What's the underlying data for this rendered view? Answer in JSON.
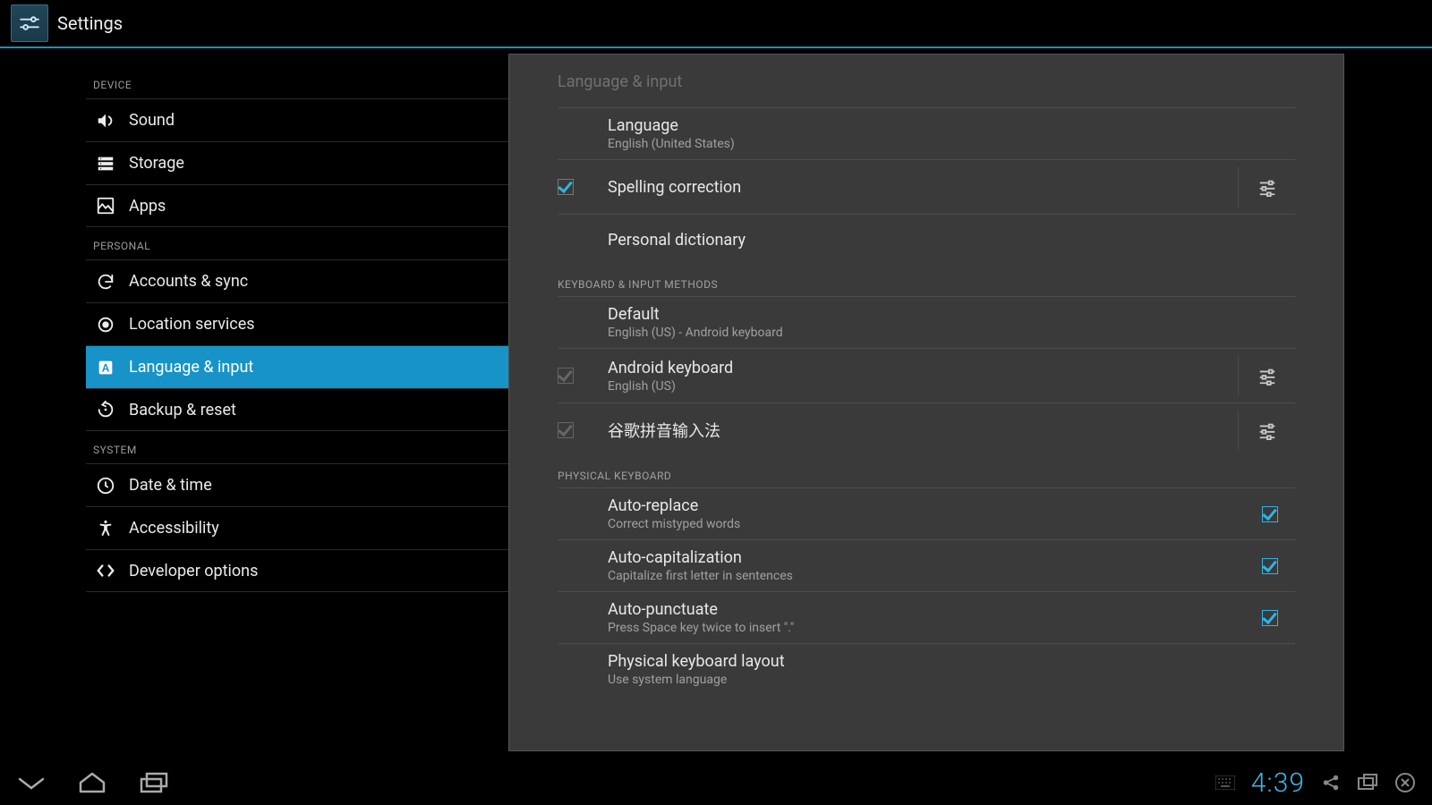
{
  "app": {
    "title": "Settings"
  },
  "sidebar": {
    "categories": [
      {
        "label": "DEVICE",
        "items": [
          {
            "id": "sound",
            "label": "Sound"
          },
          {
            "id": "storage",
            "label": "Storage"
          },
          {
            "id": "apps",
            "label": "Apps"
          }
        ]
      },
      {
        "label": "PERSONAL",
        "items": [
          {
            "id": "accounts",
            "label": "Accounts & sync"
          },
          {
            "id": "location",
            "label": "Location services"
          },
          {
            "id": "lang",
            "label": "Language & input",
            "selected": true
          },
          {
            "id": "backup",
            "label": "Backup & reset"
          }
        ]
      },
      {
        "label": "SYSTEM",
        "items": [
          {
            "id": "datetime",
            "label": "Date & time"
          },
          {
            "id": "access",
            "label": "Accessibility"
          },
          {
            "id": "dev",
            "label": "Developer options"
          }
        ]
      }
    ]
  },
  "pane": {
    "title": "Language & input",
    "language": {
      "label": "Language",
      "value": "English (United States)"
    },
    "spelling": {
      "label": "Spelling correction",
      "checked": true
    },
    "dictionary": {
      "label": "Personal dictionary"
    },
    "section_kbim": "KEYBOARD & INPUT METHODS",
    "default_kb": {
      "label": "Default",
      "value": "English (US) - Android keyboard"
    },
    "android_kb": {
      "label": "Android keyboard",
      "value": "English (US)",
      "checked": true,
      "dim": true
    },
    "pinyin_kb": {
      "label": "谷歌拼音输入法",
      "checked": true,
      "dim": true
    },
    "section_phys": "PHYSICAL KEYBOARD",
    "auto_replace": {
      "label": "Auto-replace",
      "value": "Correct mistyped words",
      "checked": true
    },
    "auto_cap": {
      "label": "Auto-capitalization",
      "value": "Capitalize first letter in sentences",
      "checked": true
    },
    "auto_punct": {
      "label": "Auto-punctuate",
      "value": "Press Space key twice to insert \".\"",
      "checked": true
    },
    "phys_layout": {
      "label": "Physical keyboard layout",
      "value": "Use system language"
    }
  },
  "status": {
    "time": "4:39"
  }
}
